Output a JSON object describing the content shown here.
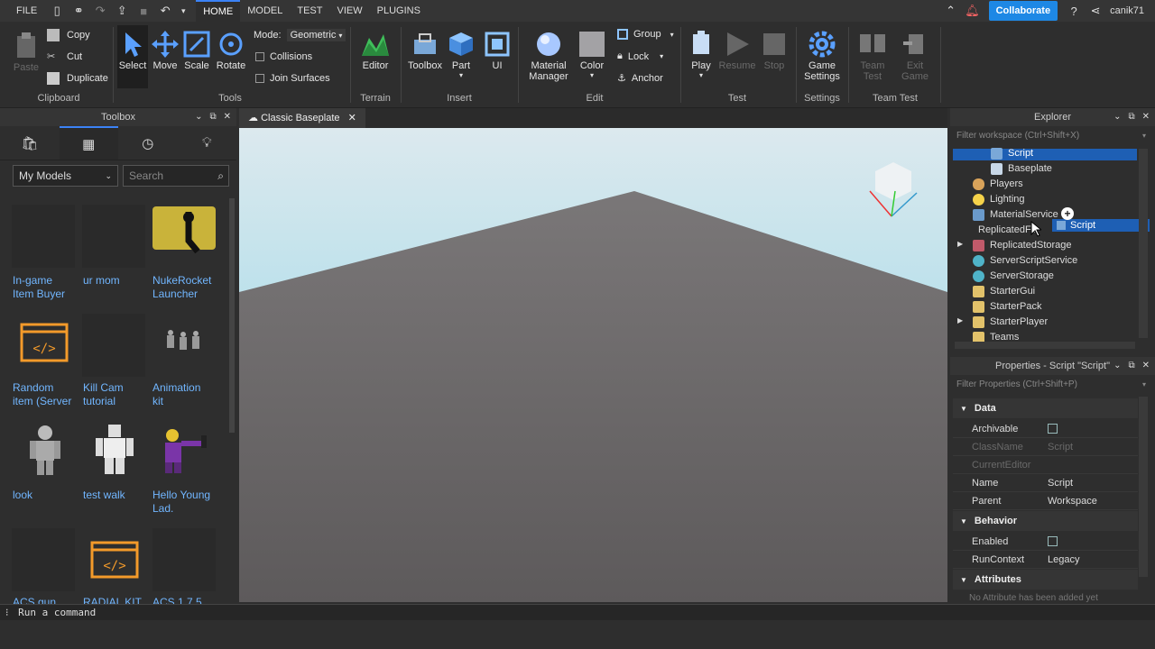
{
  "menubar": {
    "file": "FILE",
    "tabs": [
      "HOME",
      "MODEL",
      "TEST",
      "VIEW",
      "PLUGINS"
    ],
    "collaborate": "Collaborate",
    "username": "canik71"
  },
  "ribbon": {
    "clipboard": {
      "paste": "Paste",
      "copy": "Copy",
      "cut": "Cut",
      "duplicate": "Duplicate",
      "group": "Clipboard"
    },
    "tools": {
      "select": "Select",
      "move": "Move",
      "scale": "Scale",
      "rotate": "Rotate",
      "mode_label": "Mode:",
      "mode_value": "Geometric",
      "collisions": "Collisions",
      "join_surfaces": "Join Surfaces",
      "group": "Tools"
    },
    "terrain": {
      "editor": "Editor",
      "group": "Terrain"
    },
    "insert": {
      "toolbox": "Toolbox",
      "part": "Part",
      "ui": "UI",
      "group": "Insert"
    },
    "edit": {
      "material_manager_1": "Material",
      "material_manager_2": "Manager",
      "color": "Color",
      "group_btn": "Group",
      "lock": "Lock",
      "anchor": "Anchor",
      "group": "Edit"
    },
    "test": {
      "play": "Play",
      "resume": "Resume",
      "stop": "Stop",
      "group": "Test"
    },
    "settings": {
      "game_settings_1": "Game",
      "game_settings_2": "Settings",
      "group": "Settings"
    },
    "team_test": {
      "team_test_1": "Team",
      "team_test_2": "Test",
      "exit_game_1": "Exit",
      "exit_game_2": "Game",
      "group": "Team Test"
    }
  },
  "toolbox": {
    "title": "Toolbox",
    "category": "My Models",
    "search_placeholder": "Search",
    "items": [
      {
        "line1": "In-game",
        "line2": "Item Buyer"
      },
      {
        "line1": "ur mom",
        "line2": ""
      },
      {
        "line1": "NukeRocket",
        "line2": "Launcher"
      },
      {
        "line1": "Random",
        "line2": "item (Server"
      },
      {
        "line1": "Kill Cam",
        "line2": "tutorial"
      },
      {
        "line1": "Animation",
        "line2": "kit"
      },
      {
        "line1": "look",
        "line2": ""
      },
      {
        "line1": "test walk",
        "line2": ""
      },
      {
        "line1": "Hello Young",
        "line2": "Lad."
      },
      {
        "line1": "ACS gun",
        "line2": ""
      },
      {
        "line1": "RADIAL KIT",
        "line2": ""
      },
      {
        "line1": "ACS 1.7.5",
        "line2": ""
      }
    ]
  },
  "document_tab": {
    "label": "Classic Baseplate"
  },
  "explorer": {
    "title": "Explorer",
    "filter_placeholder": "Filter workspace (Ctrl+Shift+X)",
    "nodes": [
      {
        "label": "Script",
        "selected": true
      },
      {
        "label": "Baseplate"
      },
      {
        "label": "Players"
      },
      {
        "label": "Lighting"
      },
      {
        "label": "MaterialService"
      },
      {
        "label": "ReplicatedFirst"
      },
      {
        "label": "ReplicatedStorage"
      },
      {
        "label": "ServerScriptService"
      },
      {
        "label": "ServerStorage"
      },
      {
        "label": "StarterGui"
      },
      {
        "label": "StarterPack"
      },
      {
        "label": "StarterPlayer"
      },
      {
        "label": "Teams"
      }
    ],
    "drag_label": "Script"
  },
  "properties": {
    "title": "Properties - Script \"Script\"",
    "filter_placeholder": "Filter Properties (Ctrl+Shift+P)",
    "categories": {
      "data": "Data",
      "behavior": "Behavior",
      "attributes": "Attributes"
    },
    "rows": {
      "archivable": {
        "key": "Archivable"
      },
      "classname": {
        "key": "ClassName",
        "value": "Script"
      },
      "currenteditor": {
        "key": "CurrentEditor"
      },
      "name": {
        "key": "Name",
        "value": "Script"
      },
      "parent": {
        "key": "Parent",
        "value": "Workspace"
      },
      "enabled": {
        "key": "Enabled"
      },
      "runcontext": {
        "key": "RunContext",
        "value": "Legacy"
      }
    },
    "attributes_empty": "No Attribute has been added yet"
  },
  "command_bar": {
    "placeholder": "Run a command"
  },
  "colors": {
    "accent": "#3b82f6",
    "link": "#71b6ff",
    "sky": "#8fd6e6",
    "baseplate": "#6b6869"
  }
}
